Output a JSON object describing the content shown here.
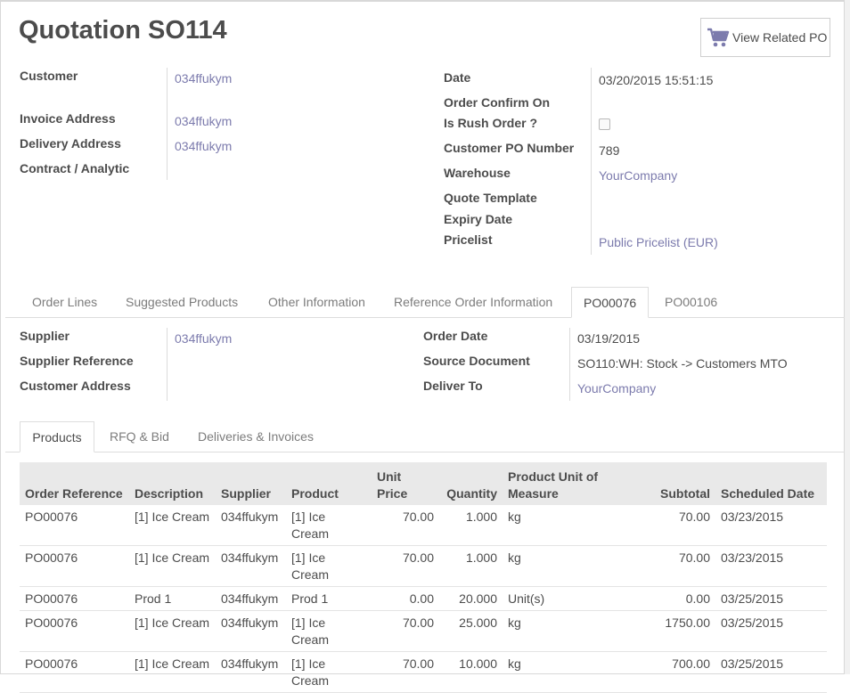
{
  "title": "Quotation SO114",
  "related_button": {
    "label": "View Related PO",
    "icon": "cart-icon"
  },
  "left_fields": [
    {
      "label": "Customer",
      "value": "034ffukym"
    },
    {
      "label": "Invoice Address",
      "value": "034ffukym"
    },
    {
      "label": "Delivery Address",
      "value": "034ffukym"
    },
    {
      "label": "Contract / Analytic",
      "value": ""
    }
  ],
  "right_fields": {
    "date": {
      "label": "Date",
      "value": "03/20/2015 15:51:15"
    },
    "order_confirm_on": {
      "label": "Order Confirm On",
      "value": ""
    },
    "is_rush_order": {
      "label": "Is Rush Order ?",
      "checked": false
    },
    "customer_po_number": {
      "label": "Customer PO Number",
      "value": "789"
    },
    "warehouse": {
      "label": "Warehouse",
      "value": "YourCompany"
    },
    "quote_template": {
      "label": "Quote Template",
      "value": ""
    },
    "expiry_date": {
      "label": "Expiry Date",
      "value": ""
    },
    "pricelist": {
      "label": "Pricelist",
      "value": "Public Pricelist (EUR)"
    }
  },
  "main_tabs": [
    {
      "label": "Order Lines",
      "active": false
    },
    {
      "label": "Suggested Products",
      "active": false
    },
    {
      "label": "Other Information",
      "active": false
    },
    {
      "label": "Reference Order Information",
      "active": false
    },
    {
      "label": "PO00076",
      "active": true
    },
    {
      "label": "PO00106",
      "active": false
    }
  ],
  "po_left": [
    {
      "label": "Supplier",
      "value": "034ffukym"
    },
    {
      "label": "Supplier Reference",
      "value": ""
    },
    {
      "label": "Customer Address",
      "value": ""
    }
  ],
  "po_right": [
    {
      "label": "Order Date",
      "value": "03/19/2015"
    },
    {
      "label": "Source Document",
      "value": "SO110:WH: Stock -> Customers MTO"
    },
    {
      "label": "Deliver To",
      "value": "YourCompany"
    }
  ],
  "sub_tabs": [
    {
      "label": "Products",
      "active": true
    },
    {
      "label": "RFQ & Bid",
      "active": false
    },
    {
      "label": "Deliveries & Invoices",
      "active": false
    }
  ],
  "table": {
    "headers": [
      "Order Reference",
      "Description",
      "Supplier",
      "Product",
      "Unit Price",
      "Quantity",
      "Product Unit of Measure",
      "Subtotal",
      "Scheduled Date"
    ],
    "rows": [
      [
        "PO00076",
        "[1] Ice Cream",
        "034ffukym",
        "[1] Ice Cream",
        "70.00",
        "1.000",
        "kg",
        "70.00",
        "03/23/2015"
      ],
      [
        "PO00076",
        "[1] Ice Cream",
        "034ffukym",
        "[1] Ice Cream",
        "70.00",
        "1.000",
        "kg",
        "70.00",
        "03/23/2015"
      ],
      [
        "PO00076",
        "Prod 1",
        "034ffukym",
        "Prod 1",
        "0.00",
        "20.000",
        "Unit(s)",
        "0.00",
        "03/25/2015"
      ],
      [
        "PO00076",
        "[1] Ice Cream",
        "034ffukym",
        "[1] Ice Cream",
        "70.00",
        "25.000",
        "kg",
        "1750.00",
        "03/25/2015"
      ],
      [
        "PO00076",
        "[1] Ice Cream",
        "034ffukym",
        "[1] Ice Cream",
        "70.00",
        "10.000",
        "kg",
        "700.00",
        "03/25/2015"
      ]
    ]
  },
  "colors": {
    "link": "#7c7bad",
    "text": "#4c4c4c",
    "header_bg": "#e9e9e9",
    "cart": "#7c7bad"
  }
}
